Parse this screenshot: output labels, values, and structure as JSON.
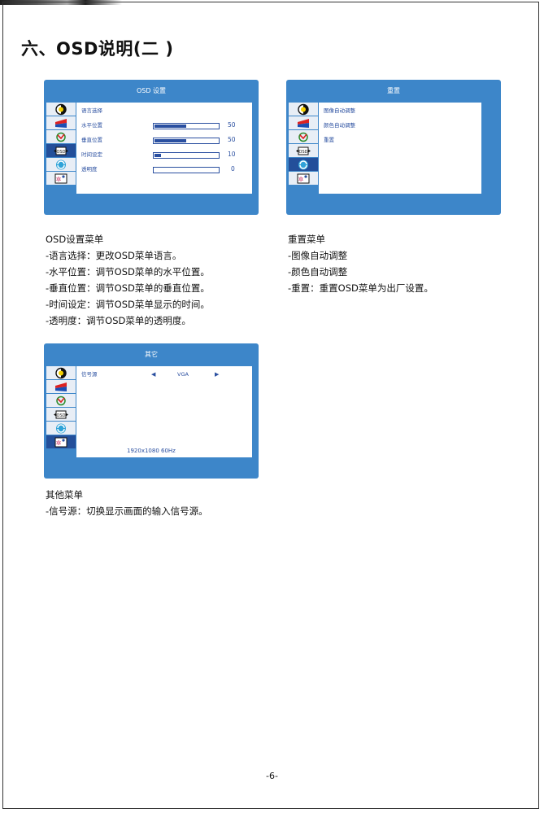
{
  "heading": "六、OSD说明(二 )",
  "panel_osd": {
    "title": "OSD 设置",
    "rows": [
      {
        "label": "语言选择"
      },
      {
        "label": "水平位置",
        "value": 50
      },
      {
        "label": "垂直位置",
        "value": 50
      },
      {
        "label": "时间设定",
        "value": 10
      },
      {
        "label": "透明度",
        "value": 0
      }
    ]
  },
  "panel_reset": {
    "title": "重置",
    "rows": [
      {
        "label": "图像自动调整"
      },
      {
        "label": "颜色自动调整"
      },
      {
        "label": "重置"
      }
    ]
  },
  "panel_other": {
    "title": "其它",
    "signal_label": "信号源",
    "signal_value": "VGA",
    "resolution": "1920x1080   60Hz"
  },
  "icons": [
    "contrast-icon",
    "color-icon",
    "picture-icon",
    "osd-icon",
    "reset-icon",
    "misc-icon"
  ],
  "desc_osd": {
    "title": "OSD设置菜单",
    "lines": [
      "-语言选择：更改OSD菜单语言。",
      "-水平位置：调节OSD菜单的水平位置。",
      "-垂直位置：调节OSD菜单的垂直位置。",
      "-时间设定：调节OSD菜单显示的时间。",
      "-透明度：调节OSD菜单的透明度。"
    ]
  },
  "desc_reset": {
    "title": "重置菜单",
    "lines": [
      "-图像自动调整",
      "-颜色自动调整",
      "-重置：重置OSD菜单为出厂设置。"
    ]
  },
  "desc_other": {
    "title": "其他菜单",
    "lines": [
      "-信号源：切换显示画面的输入信号源。"
    ]
  },
  "page_number": "-6-",
  "colors": {
    "panel": "#3d86c9",
    "accent": "#2a4fa0",
    "active_icon_bg": "#234f9a"
  }
}
